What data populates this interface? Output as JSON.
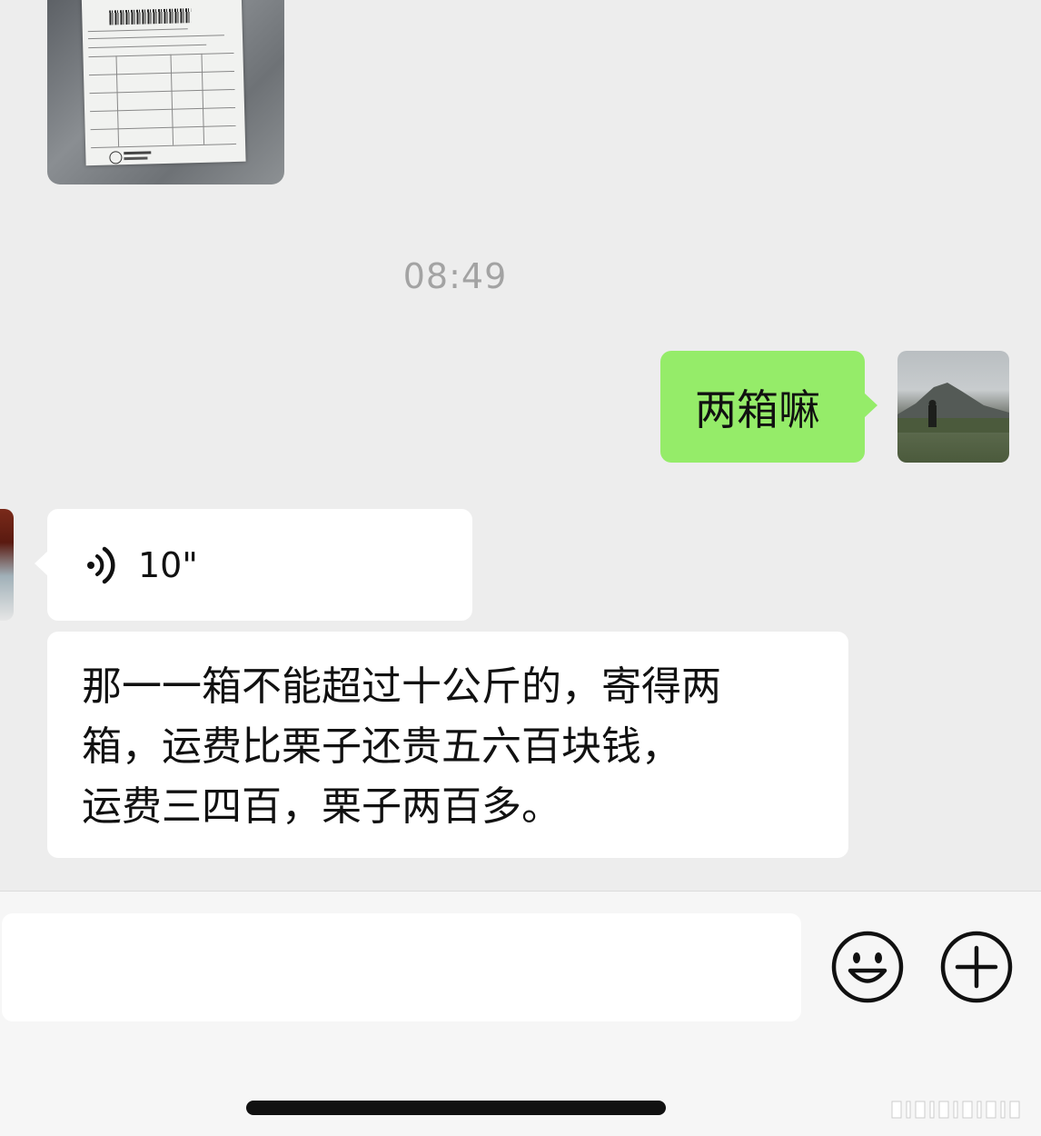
{
  "chat": {
    "timestamp": "08:49",
    "messages": [
      {
        "type": "image",
        "sender": "other",
        "subject": "sf-express-waybill"
      },
      {
        "type": "text",
        "sender": "self",
        "text": "两箱嘛"
      },
      {
        "type": "voice",
        "sender": "other",
        "duration": "10\""
      },
      {
        "type": "text",
        "sender": "other",
        "lines": [
          "那一一箱不能超过十公斤的，寄得两",
          "箱，运费比栗子还贵五六百块钱，",
          "运费三四百，栗子两百多。"
        ]
      }
    ]
  },
  "input_bar": {
    "input_value": "",
    "emoji_icon": "smiley-face-icon",
    "more_icon": "plus-circle-icon"
  },
  "colors": {
    "background": "#ededed",
    "outgoing_bubble": "#95ec69",
    "incoming_bubble": "#ffffff",
    "timestamp_text": "#a3a3a3"
  }
}
